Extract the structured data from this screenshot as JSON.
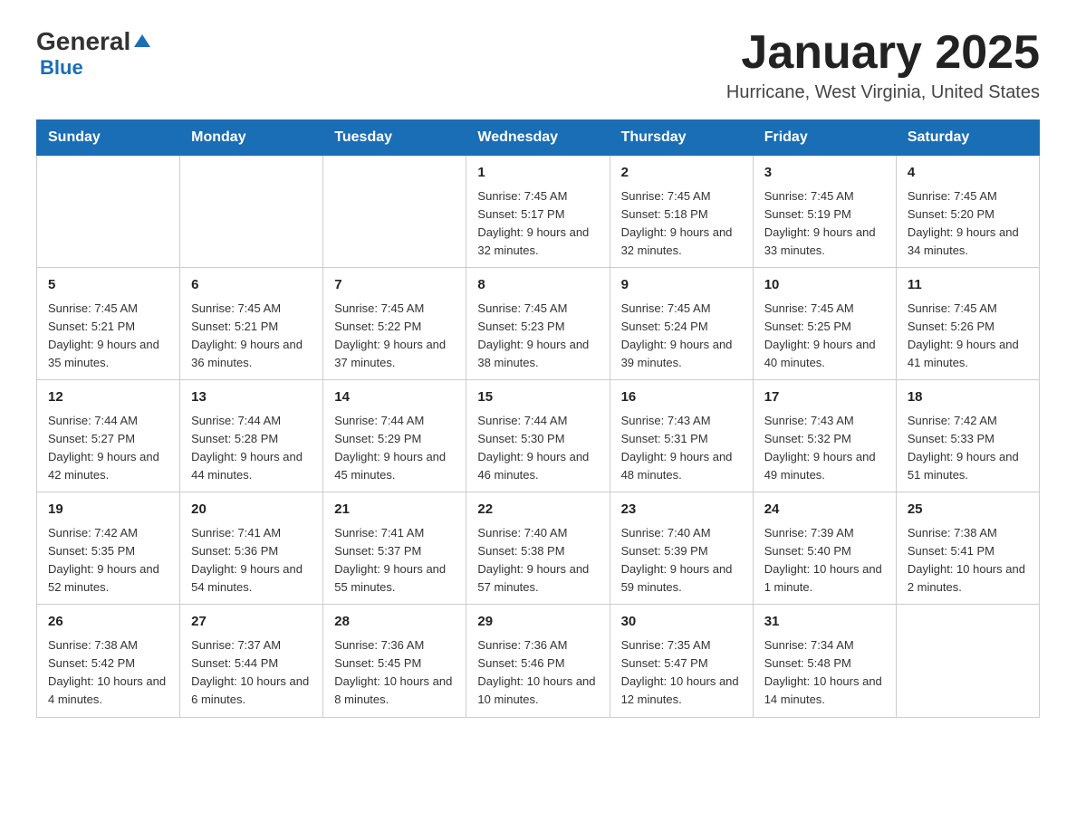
{
  "logo": {
    "general": "General",
    "triangle": "▲",
    "blue": "Blue"
  },
  "header": {
    "title": "January 2025",
    "subtitle": "Hurricane, West Virginia, United States"
  },
  "weekdays": [
    "Sunday",
    "Monday",
    "Tuesday",
    "Wednesday",
    "Thursday",
    "Friday",
    "Saturday"
  ],
  "weeks": [
    [
      {
        "day": "",
        "info": ""
      },
      {
        "day": "",
        "info": ""
      },
      {
        "day": "",
        "info": ""
      },
      {
        "day": "1",
        "info": "Sunrise: 7:45 AM\nSunset: 5:17 PM\nDaylight: 9 hours and 32 minutes."
      },
      {
        "day": "2",
        "info": "Sunrise: 7:45 AM\nSunset: 5:18 PM\nDaylight: 9 hours and 32 minutes."
      },
      {
        "day": "3",
        "info": "Sunrise: 7:45 AM\nSunset: 5:19 PM\nDaylight: 9 hours and 33 minutes."
      },
      {
        "day": "4",
        "info": "Sunrise: 7:45 AM\nSunset: 5:20 PM\nDaylight: 9 hours and 34 minutes."
      }
    ],
    [
      {
        "day": "5",
        "info": "Sunrise: 7:45 AM\nSunset: 5:21 PM\nDaylight: 9 hours and 35 minutes."
      },
      {
        "day": "6",
        "info": "Sunrise: 7:45 AM\nSunset: 5:21 PM\nDaylight: 9 hours and 36 minutes."
      },
      {
        "day": "7",
        "info": "Sunrise: 7:45 AM\nSunset: 5:22 PM\nDaylight: 9 hours and 37 minutes."
      },
      {
        "day": "8",
        "info": "Sunrise: 7:45 AM\nSunset: 5:23 PM\nDaylight: 9 hours and 38 minutes."
      },
      {
        "day": "9",
        "info": "Sunrise: 7:45 AM\nSunset: 5:24 PM\nDaylight: 9 hours and 39 minutes."
      },
      {
        "day": "10",
        "info": "Sunrise: 7:45 AM\nSunset: 5:25 PM\nDaylight: 9 hours and 40 minutes."
      },
      {
        "day": "11",
        "info": "Sunrise: 7:45 AM\nSunset: 5:26 PM\nDaylight: 9 hours and 41 minutes."
      }
    ],
    [
      {
        "day": "12",
        "info": "Sunrise: 7:44 AM\nSunset: 5:27 PM\nDaylight: 9 hours and 42 minutes."
      },
      {
        "day": "13",
        "info": "Sunrise: 7:44 AM\nSunset: 5:28 PM\nDaylight: 9 hours and 44 minutes."
      },
      {
        "day": "14",
        "info": "Sunrise: 7:44 AM\nSunset: 5:29 PM\nDaylight: 9 hours and 45 minutes."
      },
      {
        "day": "15",
        "info": "Sunrise: 7:44 AM\nSunset: 5:30 PM\nDaylight: 9 hours and 46 minutes."
      },
      {
        "day": "16",
        "info": "Sunrise: 7:43 AM\nSunset: 5:31 PM\nDaylight: 9 hours and 48 minutes."
      },
      {
        "day": "17",
        "info": "Sunrise: 7:43 AM\nSunset: 5:32 PM\nDaylight: 9 hours and 49 minutes."
      },
      {
        "day": "18",
        "info": "Sunrise: 7:42 AM\nSunset: 5:33 PM\nDaylight: 9 hours and 51 minutes."
      }
    ],
    [
      {
        "day": "19",
        "info": "Sunrise: 7:42 AM\nSunset: 5:35 PM\nDaylight: 9 hours and 52 minutes."
      },
      {
        "day": "20",
        "info": "Sunrise: 7:41 AM\nSunset: 5:36 PM\nDaylight: 9 hours and 54 minutes."
      },
      {
        "day": "21",
        "info": "Sunrise: 7:41 AM\nSunset: 5:37 PM\nDaylight: 9 hours and 55 minutes."
      },
      {
        "day": "22",
        "info": "Sunrise: 7:40 AM\nSunset: 5:38 PM\nDaylight: 9 hours and 57 minutes."
      },
      {
        "day": "23",
        "info": "Sunrise: 7:40 AM\nSunset: 5:39 PM\nDaylight: 9 hours and 59 minutes."
      },
      {
        "day": "24",
        "info": "Sunrise: 7:39 AM\nSunset: 5:40 PM\nDaylight: 10 hours and 1 minute."
      },
      {
        "day": "25",
        "info": "Sunrise: 7:38 AM\nSunset: 5:41 PM\nDaylight: 10 hours and 2 minutes."
      }
    ],
    [
      {
        "day": "26",
        "info": "Sunrise: 7:38 AM\nSunset: 5:42 PM\nDaylight: 10 hours and 4 minutes."
      },
      {
        "day": "27",
        "info": "Sunrise: 7:37 AM\nSunset: 5:44 PM\nDaylight: 10 hours and 6 minutes."
      },
      {
        "day": "28",
        "info": "Sunrise: 7:36 AM\nSunset: 5:45 PM\nDaylight: 10 hours and 8 minutes."
      },
      {
        "day": "29",
        "info": "Sunrise: 7:36 AM\nSunset: 5:46 PM\nDaylight: 10 hours and 10 minutes."
      },
      {
        "day": "30",
        "info": "Sunrise: 7:35 AM\nSunset: 5:47 PM\nDaylight: 10 hours and 12 minutes."
      },
      {
        "day": "31",
        "info": "Sunrise: 7:34 AM\nSunset: 5:48 PM\nDaylight: 10 hours and 14 minutes."
      },
      {
        "day": "",
        "info": ""
      }
    ]
  ]
}
